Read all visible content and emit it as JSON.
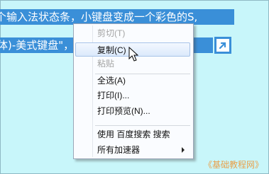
{
  "document": {
    "line1": "个输入法状态条，小键盘变成一个彩色的S,",
    "line2": "体)-美式键盘\"，                              态；"
  },
  "context_menu": {
    "items": [
      {
        "label": "剪切(T)",
        "enabled": false
      },
      {
        "label": "复制(C)",
        "enabled": true,
        "hovered": true
      },
      {
        "label": "粘贴",
        "enabled": false
      },
      {
        "label": "全选(A)",
        "enabled": true
      },
      {
        "label": "打印(I)...",
        "enabled": true
      },
      {
        "label": "打印预览(N)...",
        "enabled": true
      },
      {
        "label": "使用 百度搜索 搜索",
        "enabled": true
      },
      {
        "label": "所有加速器",
        "enabled": true,
        "has_submenu": true
      }
    ]
  },
  "watermark": "《基础教程网》",
  "colors": {
    "selection": "#3a8fd8",
    "background": "#c8f6fa",
    "watermark": "#e9a04a"
  },
  "icons": {
    "accelerator_button": "arrow-icon",
    "cursor": "mouse-pointer-icon",
    "submenu": "chevron-right-icon"
  }
}
